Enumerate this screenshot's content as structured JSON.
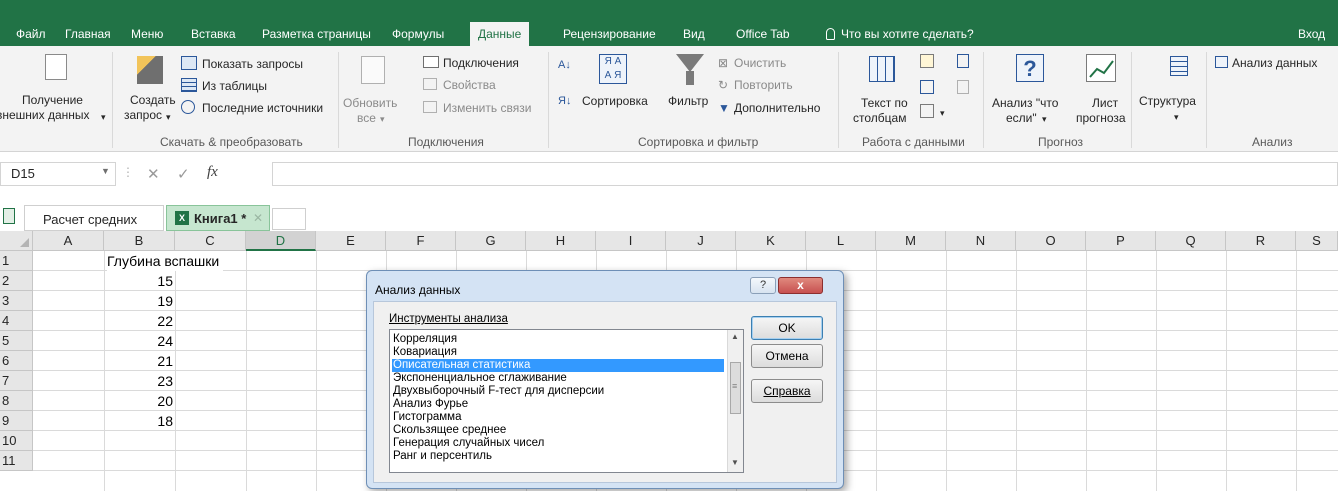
{
  "ribbon_tabs": [
    "Файл",
    "Главная",
    "Меню",
    "Вставка",
    "Разметка страницы",
    "Формулы",
    "Данные",
    "Рецензирование",
    "Вид",
    "Office Tab"
  ],
  "tell_me": "Что вы хотите сделать?",
  "sign_in": "Вход",
  "ribbon": {
    "get_data_1": "Получение",
    "get_data_2": "внешних данных",
    "create_1": "Создать",
    "create_2": "запрос",
    "show_queries": "Показать запросы",
    "from_table": "Из таблицы",
    "recent_sources": "Последние источники",
    "group_get_transform": "Скачать & преобразовать",
    "refresh_1": "Обновить",
    "refresh_2": "все",
    "connections": "Подключения",
    "properties": "Свойства",
    "edit_links": "Изменить связи",
    "group_connections": "Подключения",
    "sort": "Сортировка",
    "filter": "Фильтр",
    "clear": "Очистить",
    "reapply": "Повторить",
    "advanced": "Дополнительно",
    "group_sort_filter": "Сортировка и фильтр",
    "text_cols_1": "Текст по",
    "text_cols_2": "столбцам",
    "group_data_tools": "Работа с данными",
    "whatif_1": "Анализ \"что",
    "whatif_2": "если\"",
    "forecast_1": "Лист",
    "forecast_2": "прогноза",
    "group_forecast": "Прогноз",
    "outline": "Структура",
    "data_analysis": "Анализ данных",
    "group_analysis": "Анализ"
  },
  "formula_bar": {
    "name_box": "D15",
    "fx": "fx",
    "value": ""
  },
  "workbook_tabs": [
    "Расчет средних",
    "Книга1 *"
  ],
  "columns": [
    "A",
    "B",
    "C",
    "D",
    "E",
    "F",
    "G",
    "H",
    "I",
    "J",
    "K",
    "L",
    "M",
    "N",
    "O",
    "P",
    "Q",
    "R",
    "S"
  ],
  "rows": [
    "1",
    "2",
    "3",
    "4",
    "5",
    "6",
    "7",
    "8",
    "9",
    "10",
    "11"
  ],
  "cells": {
    "b1": "Глубина вспашки",
    "values": [
      "15",
      "19",
      "22",
      "24",
      "21",
      "23",
      "20",
      "18"
    ]
  },
  "dialog": {
    "title": "Анализ данных",
    "help_glyph": "?",
    "close_glyph": "x",
    "tools_label": "Инструменты анализа",
    "items": [
      "Корреляция",
      "Ковариация",
      "Описательная статистика",
      "Экспоненциальное сглаживание",
      "Двухвыборочный F-тест для дисперсии",
      "Анализ Фурье",
      "Гистограмма",
      "Скользящее среднее",
      "Генерация случайных чисел",
      "Ранг и персентиль"
    ],
    "selected_index": 2,
    "ok": "OK",
    "cancel": "Отмена",
    "help": "Справка"
  },
  "colors": {
    "ribbon_green": "#217346",
    "selection_blue": "#3399ff",
    "dialog_bg": "#d4e3f4",
    "close_red": "#c75050"
  }
}
